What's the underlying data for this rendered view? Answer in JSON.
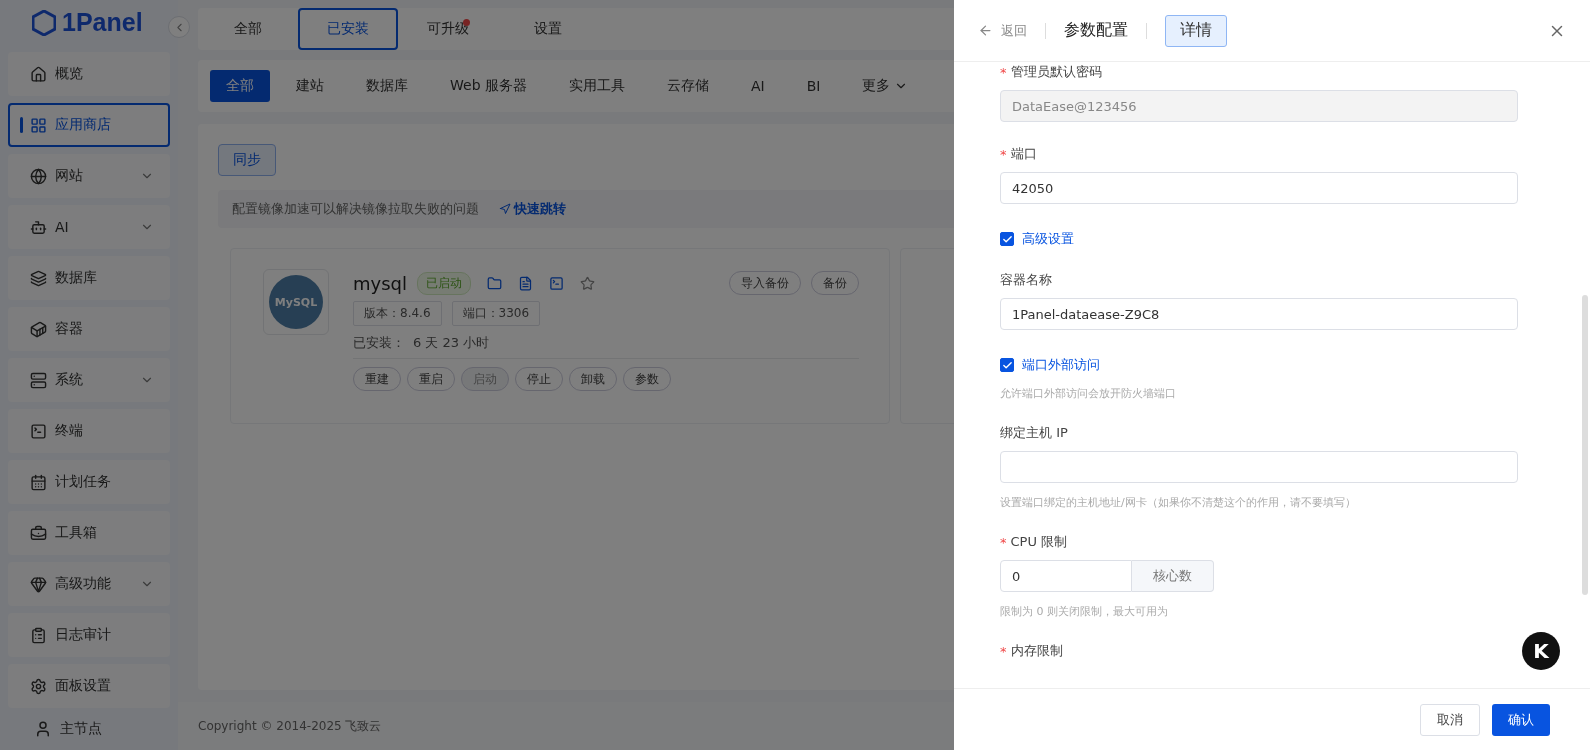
{
  "logo": "1Panel",
  "sidebar": {
    "items": [
      {
        "label": "概览",
        "expandable": false,
        "selected": false
      },
      {
        "label": "应用商店",
        "expandable": false,
        "selected": true
      },
      {
        "label": "网站",
        "expandable": true,
        "selected": false
      },
      {
        "label": "AI",
        "expandable": true,
        "selected": false
      },
      {
        "label": "数据库",
        "expandable": false,
        "selected": false
      },
      {
        "label": "容器",
        "expandable": false,
        "selected": false
      },
      {
        "label": "系统",
        "expandable": true,
        "selected": false
      },
      {
        "label": "终端",
        "expandable": false,
        "selected": false
      },
      {
        "label": "计划任务",
        "expandable": false,
        "selected": false
      },
      {
        "label": "工具箱",
        "expandable": false,
        "selected": false
      },
      {
        "label": "高级功能",
        "expandable": true,
        "selected": false
      },
      {
        "label": "日志审计",
        "expandable": false,
        "selected": false
      },
      {
        "label": "面板设置",
        "expandable": false,
        "selected": false
      }
    ],
    "node": "主节点"
  },
  "top_tabs": [
    {
      "label": "全部",
      "selected": false,
      "badge": false
    },
    {
      "label": "已安装",
      "selected": true,
      "badge": false
    },
    {
      "label": "可升级",
      "selected": false,
      "badge": true
    },
    {
      "label": "设置",
      "selected": false,
      "badge": false
    }
  ],
  "categories": [
    {
      "label": "全部",
      "selected": true,
      "kind": "tab"
    },
    {
      "label": "建站",
      "selected": false,
      "kind": "tab"
    },
    {
      "label": "数据库",
      "selected": false,
      "kind": "tab"
    },
    {
      "label": "Web 服务器",
      "selected": false,
      "kind": "tab"
    },
    {
      "label": "实用工具",
      "selected": false,
      "kind": "tab"
    },
    {
      "label": "云存储",
      "selected": false,
      "kind": "tab"
    },
    {
      "label": "AI",
      "selected": false,
      "kind": "tab"
    },
    {
      "label": "BI",
      "selected": false,
      "kind": "tab"
    },
    {
      "label": "更多",
      "selected": false,
      "kind": "dropdown"
    }
  ],
  "sync_button": "同步",
  "notice": {
    "text": "配置镜像加速可以解决镜像拉取失败的问题",
    "link": "快速跳转"
  },
  "app_card": {
    "logo_text": "MySQL",
    "name": "mysql",
    "status": "已启动",
    "tags": [
      "版本：8.4.6",
      "端口：3306"
    ],
    "installed_label": "已安装：",
    "installed_value": "6 天 23 小时",
    "top_actions": [
      "导入备份",
      "备份"
    ],
    "actions": [
      {
        "label": "重建",
        "disabled": false
      },
      {
        "label": "重启",
        "disabled": false
      },
      {
        "label": "启动",
        "disabled": true
      },
      {
        "label": "停止",
        "disabled": false
      },
      {
        "label": "卸载",
        "disabled": false
      },
      {
        "label": "参数",
        "disabled": false
      }
    ]
  },
  "copyright": "Copyright © 2014-2025 飞致云",
  "drawer": {
    "back": "返回",
    "title": "参数配置",
    "tab": {
      "label": "详情",
      "selected": true
    },
    "fields": [
      {
        "kind": "input",
        "required_mark": "*",
        "label": "管理员默认密码",
        "value": "DataEase@123456",
        "disabled": true
      },
      {
        "kind": "input",
        "required_mark": "*",
        "label": "端口",
        "value": "42050"
      },
      {
        "kind": "checkbox",
        "label": "高级设置",
        "checked": true
      },
      {
        "kind": "input",
        "label": "容器名称",
        "value": "1Panel-dataease-Z9C8"
      },
      {
        "kind": "checkbox",
        "label": "端口外部访问",
        "checked": true,
        "hint": "允许端口外部访问会放开防火墙端口"
      },
      {
        "kind": "input",
        "label": "绑定主机 IP",
        "hint": "设置端口绑定的主机地址/网卡（如果你不清楚这个的作用，请不要填写）"
      },
      {
        "kind": "suffix_input",
        "required_mark": "*",
        "label": "CPU 限制",
        "value": "0",
        "suffix": "核心数",
        "hint": "限制为 0 则关闭限制，最大可用为"
      },
      {
        "kind": "label",
        "required_mark": "*",
        "label": "内存限制"
      }
    ],
    "cancel": "取消",
    "confirm": "确认"
  },
  "float_button": "K"
}
